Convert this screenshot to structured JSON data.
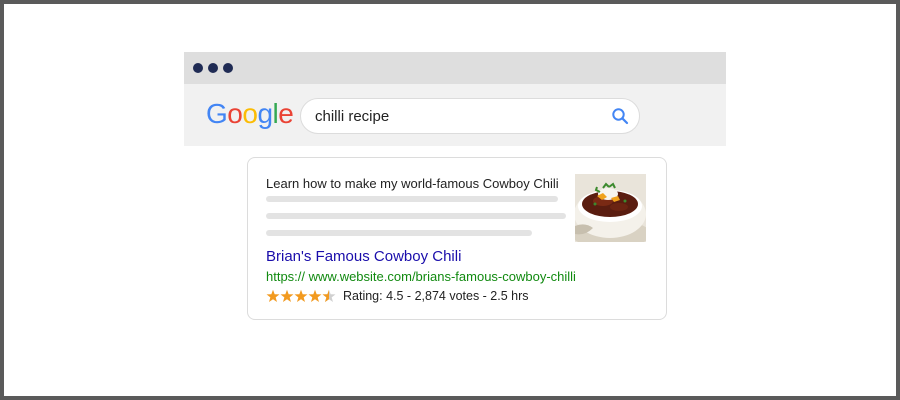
{
  "browser": {
    "window_dots": 3,
    "logo_letters": [
      {
        "char": "G",
        "color": "#4285F4"
      },
      {
        "char": "o",
        "color": "#EA4335"
      },
      {
        "char": "o",
        "color": "#FBBC05"
      },
      {
        "char": "g",
        "color": "#4285F4"
      },
      {
        "char": "l",
        "color": "#34A853"
      },
      {
        "char": "e",
        "color": "#EA4335"
      }
    ],
    "search": {
      "query": "chilli recipe",
      "icon": "search-icon"
    }
  },
  "result": {
    "snippet_title": "Learn how to make my world-famous Cowboy Chili",
    "thumbnail": "chili-bowl-image",
    "link_text": "Brian's Famous Cowboy Chili",
    "url": "https:// www.website.com/brians-famous-cowboy-chilli",
    "rating_value": 4.5,
    "rating_max": 5,
    "rating_text": "Rating: 4.5 - 2,874 votes - 2.5 hrs"
  },
  "colors": {
    "frame": "#5a5a5a",
    "titlebar": "#dedede",
    "window_dot": "#1f2b54",
    "link": "#1a0dab",
    "url": "#118a10",
    "star": "#f29a1f"
  }
}
